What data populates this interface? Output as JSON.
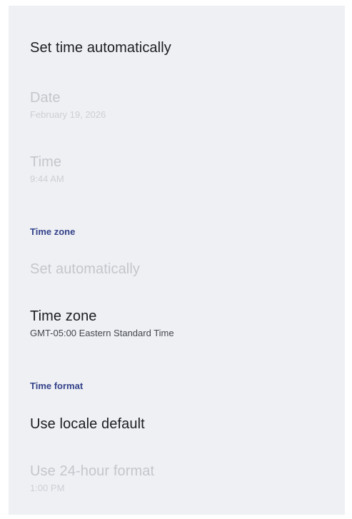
{
  "date_time": {
    "set_time_automatically": {
      "title": "Set time automatically",
      "enabled": true
    },
    "date": {
      "title": "Date",
      "summary": "February 19, 2026",
      "enabled": false
    },
    "time": {
      "title": "Time",
      "summary": "9:44 AM",
      "enabled": false
    }
  },
  "time_zone_section": {
    "header": "Time zone",
    "set_automatically": {
      "title": "Set automatically",
      "enabled": false
    },
    "time_zone": {
      "title": "Time zone",
      "summary": "GMT-05:00 Eastern Standard Time",
      "enabled": true
    }
  },
  "time_format_section": {
    "header": "Time format",
    "use_locale_default": {
      "title": "Use locale default",
      "enabled": true
    },
    "use_24_hour": {
      "title": "Use 24-hour format",
      "summary": "1:00 PM",
      "enabled": false
    }
  },
  "colors": {
    "background": "#eef0f4",
    "primary_text": "#1b1c1f",
    "disabled_text": "#c4c6cb",
    "section_header": "#34428a"
  }
}
